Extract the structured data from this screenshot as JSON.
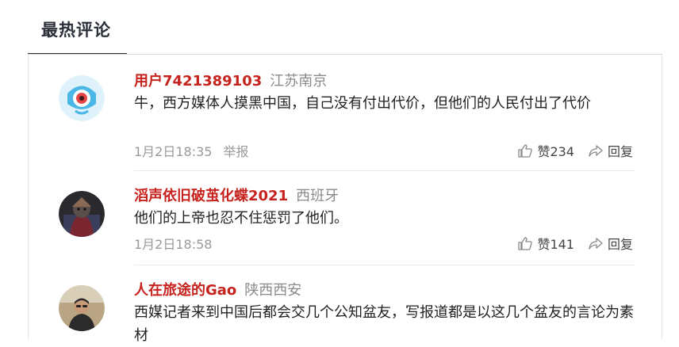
{
  "section_title": "最热评论",
  "colors": {
    "username": "#c7231e",
    "meta": "#999999",
    "title": "#2b2f3a"
  },
  "comments": [
    {
      "username": "用户7421389103",
      "location": "江苏南京",
      "text": "牛，西方媒体人摸黑中国，自己没有付出代价，但他们的人民付出了代价",
      "time": "1月2日18:35",
      "report_label": "举报",
      "like_label": "赞234",
      "reply_label": "回复",
      "avatar_icon": "weibo-eye-icon"
    },
    {
      "username": "滔声依旧破茧化蝶2021",
      "location": "西班牙",
      "text": "他们的上帝也忍不住惩罚了他们。",
      "time": "1月2日18:58",
      "like_label": "赞141",
      "reply_label": "回复",
      "avatar_icon": "user-photo"
    },
    {
      "username": "人在旅途的Gao",
      "location": "陕西西安",
      "text": "西媒记者来到中国后都会交几个公知盆友，写报道都是以这几个盆友的言论为素材",
      "avatar_icon": "user-photo"
    }
  ]
}
